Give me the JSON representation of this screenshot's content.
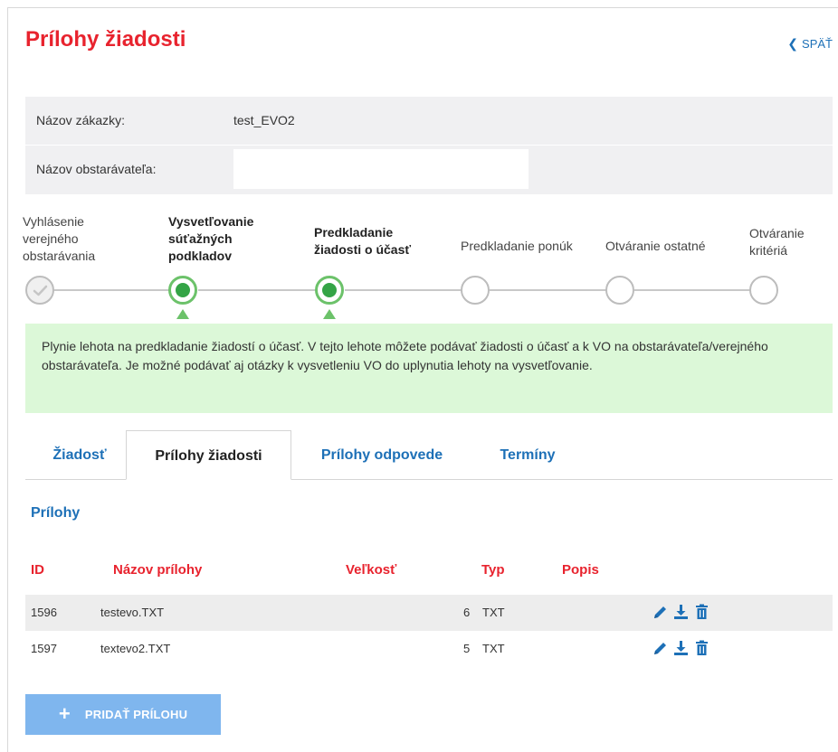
{
  "page": {
    "title": "Prílohy žiadosti",
    "back_label": "SPÄŤ"
  },
  "info": {
    "contract_name_label": "Názov zákazky:",
    "contract_name_value": "test_EVO2",
    "procurer_name_label": "Názov obstarávateľa:",
    "procurer_name_value": ""
  },
  "stepper": {
    "steps": [
      {
        "label": "Vyhlásenie verejného obstarávania",
        "state": "done"
      },
      {
        "label": "Vysvetľovanie súťažných podkladov",
        "state": "active"
      },
      {
        "label": "Predkladanie žiadosti o účasť",
        "state": "active"
      },
      {
        "label": "Predkladanie ponúk",
        "state": "pending"
      },
      {
        "label": "Otváranie ostatné",
        "state": "pending"
      },
      {
        "label": "Otváranie kritériá",
        "state": "pending"
      }
    ]
  },
  "notice": {
    "text": "Plynie lehota na predkladanie žiadostí o účasť. V tejto lehote môžete podávať žiadosti o účasť a k VO na obstarávateľa/verejného obstarávateľa. Je možné podávať aj otázky k vysvetleniu VO do uplynutia lehoty na vysvetľovanie."
  },
  "tabs": [
    {
      "label": "Žiadosť"
    },
    {
      "label": "Prílohy žiadosti"
    },
    {
      "label": "Prílohy odpovede"
    },
    {
      "label": "Termíny"
    }
  ],
  "attachments": {
    "section_title": "Prílohy",
    "columns": [
      "ID",
      "Názov prílohy",
      "Veľkosť",
      "Typ",
      "Popis"
    ],
    "rows": [
      {
        "id": "1596",
        "name": "testevo.TXT",
        "size": "6",
        "type": "TXT",
        "description": ""
      },
      {
        "id": "1597",
        "name": "textevo2.TXT",
        "size": "5",
        "type": "TXT",
        "description": ""
      }
    ],
    "add_button_label": "PRIDAŤ PRÍLOHU"
  },
  "colors": {
    "title_red": "#e8232e",
    "link_blue": "#1d70b7",
    "active_green": "#34a446",
    "notice_bg": "#dcf8d8",
    "button_blue": "#7fb6ee"
  },
  "icons": {
    "back": "chevron-left-icon",
    "done_step": "check-icon",
    "edit": "pencil-icon",
    "download": "download-icon",
    "delete": "trash-icon",
    "add": "plus-icon"
  }
}
